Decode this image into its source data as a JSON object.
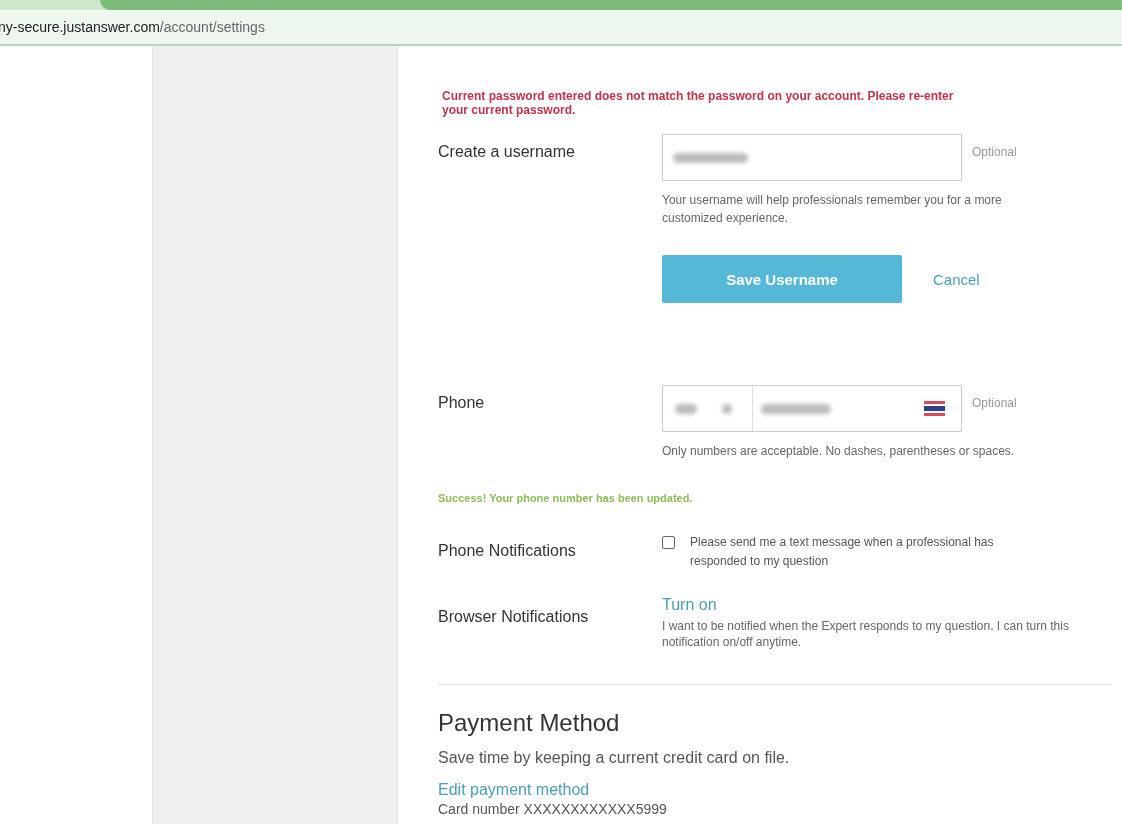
{
  "browser": {
    "url_host": "ny-secure.justanswer.com",
    "url_path": "/account/settings"
  },
  "error_message": "Current password entered does not match the password on your account. Please re-enter your current password.",
  "username": {
    "label": "Create a username",
    "optional": "Optional",
    "help": "Your username will help professionals remember you for a more customized experience.",
    "save_button": "Save Username",
    "cancel": "Cancel"
  },
  "phone": {
    "label": "Phone",
    "optional": "Optional",
    "help": "Only numbers are acceptable. No dashes, parentheses or spaces.",
    "success": "Success! Your phone number has been updated."
  },
  "phone_notifications": {
    "label": "Phone Notifications",
    "checked": false,
    "text": "Please send me a text message when a professional has responded to my question"
  },
  "browser_notifications": {
    "label": "Browser Notifications",
    "link": "Turn on",
    "text": "I want to be notified when the Expert responds to my question. I can turn this notification on/off anytime."
  },
  "payment": {
    "title": "Payment Method",
    "description": "Save time by keeping a current credit card on file.",
    "link": "Edit payment method",
    "card": "Card number XXXXXXXXXXXX5999"
  }
}
